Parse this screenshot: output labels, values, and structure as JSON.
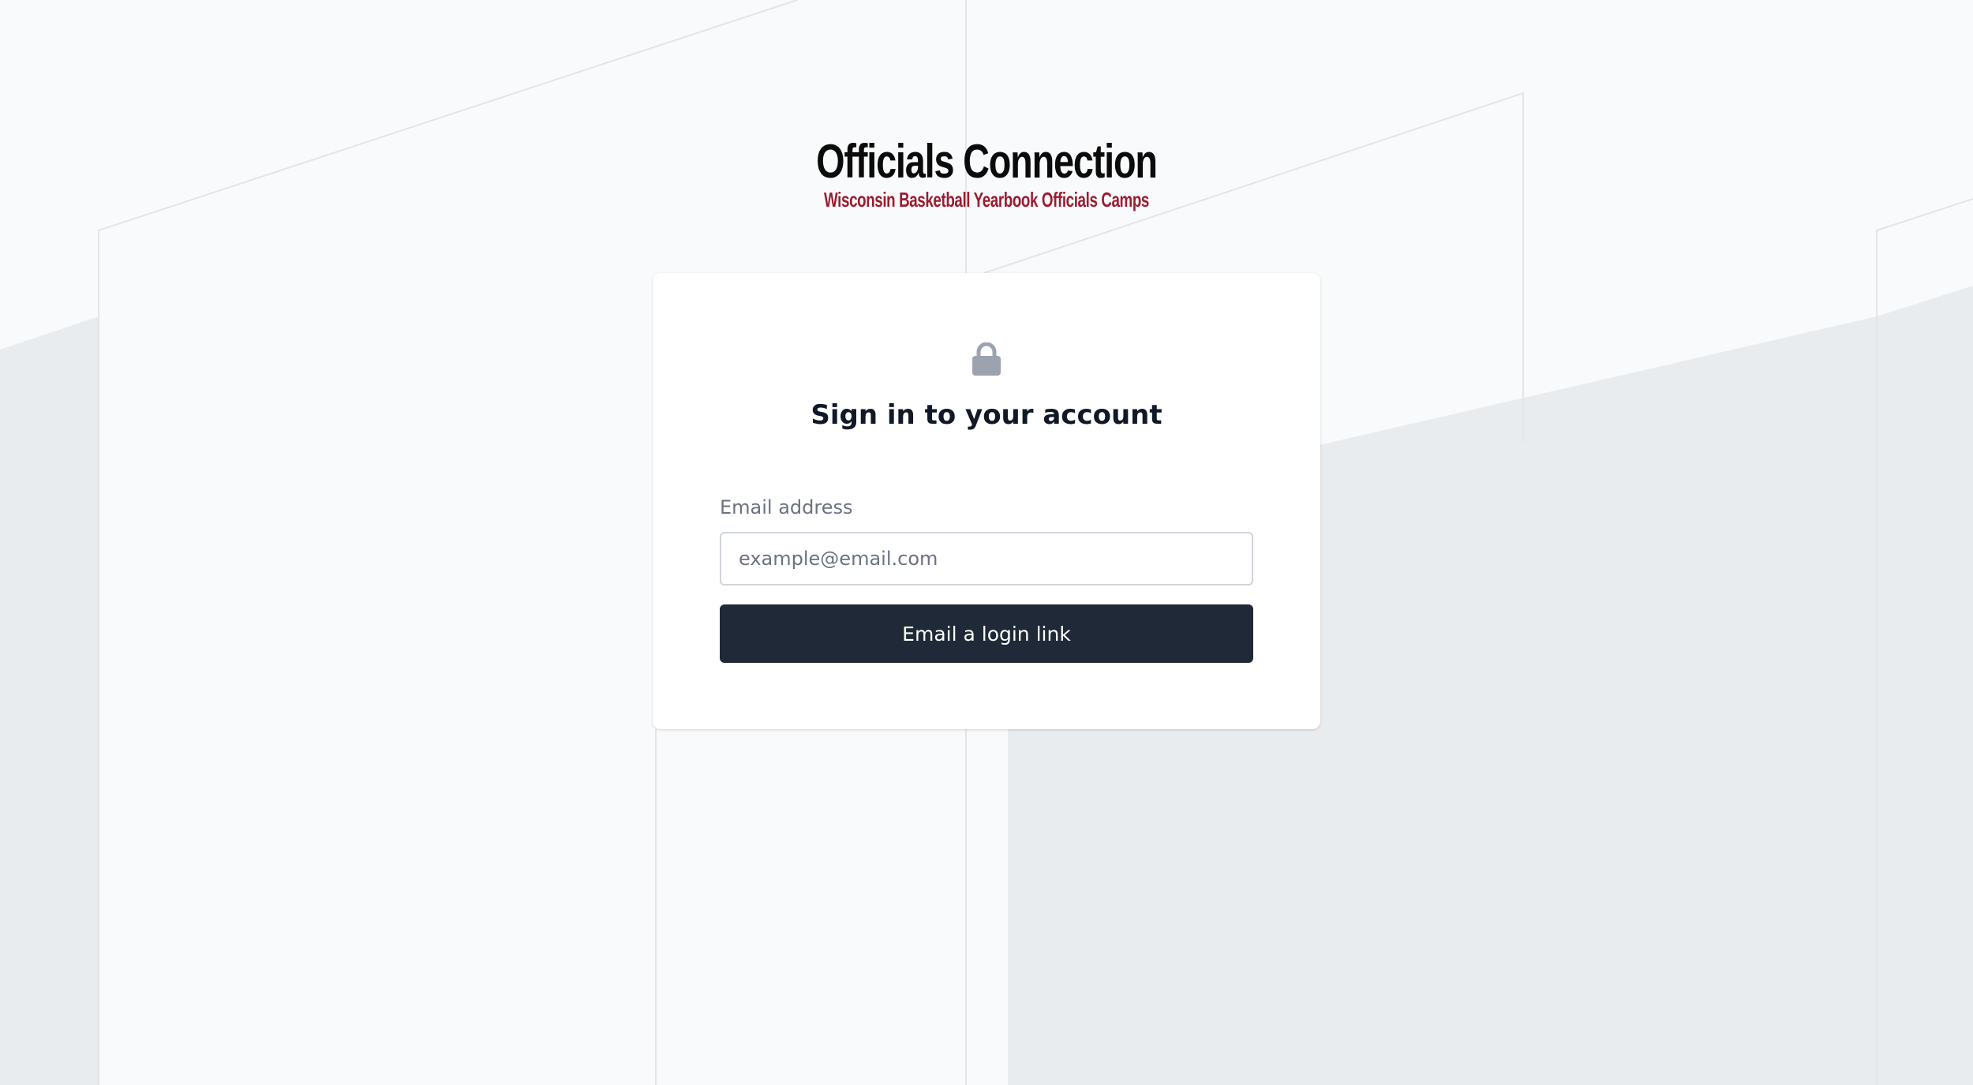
{
  "brand": {
    "title": "Officials Connection",
    "subtitle": "Wisconsin Basketball Yearbook Officials Camps"
  },
  "login_card": {
    "icon": "lock-icon",
    "heading": "Sign in to your account",
    "email_label": "Email address",
    "email_value": "",
    "email_placeholder": "example@email.com",
    "submit_label": "Email a login link"
  },
  "colors": {
    "background": "#f9fafb",
    "background_band": "#e9ecef",
    "brand_title": "#0b0b0b",
    "brand_subtitle": "#9b1c31",
    "button": "#1f2937",
    "lock_icon": "#9ca3af"
  }
}
